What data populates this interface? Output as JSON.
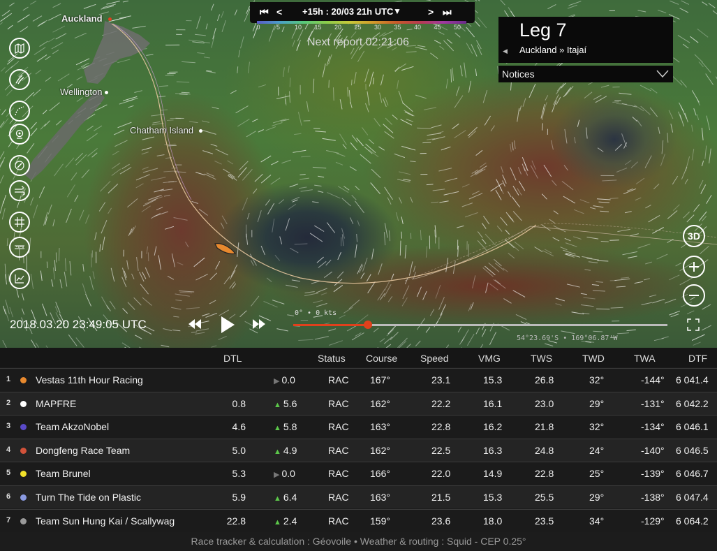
{
  "header": {
    "time_step": "+15h : 20/03 21h UTC",
    "next_report": "Next report 02:21:06",
    "scale_labels": [
      "0",
      "5",
      "10",
      "15",
      "20",
      "25",
      "30",
      "35",
      "40",
      "45",
      "50"
    ]
  },
  "leg": {
    "title": "Leg 7",
    "route": "Auckland » Itajaí",
    "notices_label": "Notices"
  },
  "places": {
    "auckland": "Auckland",
    "wellington": "Wellington",
    "chatham": "Chatham Island"
  },
  "map_controls": {
    "btn_3d": "3D"
  },
  "playback": {
    "datetime": "2018.03.20 23:49:05 UTC",
    "wind_readout": "0° • 0 kts",
    "progress": 0.2,
    "coords": "54°23.69'S • 169°06.87'W"
  },
  "table": {
    "columns": [
      "DTL",
      "Status",
      "Course",
      "Speed",
      "VMG",
      "TWS",
      "TWD",
      "TWA",
      "DTF"
    ],
    "rows": [
      {
        "rank": "1",
        "team": "Vestas 11th Hour Racing",
        "color": "#e8892e",
        "dtl": "",
        "trend": "▶",
        "trend_color": "#777",
        "delta": "0.0",
        "status": "RAC",
        "course": "167°",
        "speed": "23.1",
        "vmg": "15.3",
        "tws": "26.8",
        "twd": "32°",
        "twa": "-144°",
        "dtf": "6 041.4"
      },
      {
        "rank": "2",
        "team": "MAPFRE",
        "color": "#ffffff",
        "dtl": "0.8",
        "trend": "▲",
        "trend_color": "#5cc84a",
        "delta": "5.6",
        "status": "RAC",
        "course": "162°",
        "speed": "22.2",
        "vmg": "16.1",
        "tws": "23.0",
        "twd": "29°",
        "twa": "-131°",
        "dtf": "6 042.2"
      },
      {
        "rank": "3",
        "team": "Team AkzoNobel",
        "color": "#5a4ac8",
        "dtl": "4.6",
        "trend": "▲",
        "trend_color": "#5cc84a",
        "delta": "5.8",
        "status": "RAC",
        "course": "163°",
        "speed": "22.8",
        "vmg": "16.2",
        "tws": "21.8",
        "twd": "32°",
        "twa": "-134°",
        "dtf": "6 046.1"
      },
      {
        "rank": "4",
        "team": "Dongfeng Race Team",
        "color": "#d2523a",
        "dtl": "5.0",
        "trend": "▲",
        "trend_color": "#5cc84a",
        "delta": "4.9",
        "status": "RAC",
        "course": "162°",
        "speed": "22.5",
        "vmg": "16.3",
        "tws": "24.8",
        "twd": "24°",
        "twa": "-140°",
        "dtf": "6 046.5"
      },
      {
        "rank": "5",
        "team": "Team Brunel",
        "color": "#f0e02a",
        "dtl": "5.3",
        "trend": "▶",
        "trend_color": "#777",
        "delta": "0.0",
        "status": "RAC",
        "course": "166°",
        "speed": "22.0",
        "vmg": "14.9",
        "tws": "22.8",
        "twd": "25°",
        "twa": "-139°",
        "dtf": "6 046.7"
      },
      {
        "rank": "6",
        "team": "Turn The Tide on Plastic",
        "color": "#8a9ae0",
        "dtl": "5.9",
        "trend": "▲",
        "trend_color": "#5cc84a",
        "delta": "6.4",
        "status": "RAC",
        "course": "163°",
        "speed": "21.5",
        "vmg": "15.3",
        "tws": "25.5",
        "twd": "29°",
        "twa": "-138°",
        "dtf": "6 047.4"
      },
      {
        "rank": "7",
        "team": "Team Sun Hung Kai / Scallywag",
        "color": "#9a9a9a",
        "dtl": "22.8",
        "trend": "▲",
        "trend_color": "#5cc84a",
        "delta": "2.4",
        "status": "RAC",
        "course": "159°",
        "speed": "23.6",
        "vmg": "18.0",
        "tws": "23.5",
        "twd": "34°",
        "twa": "-129°",
        "dtf": "6 064.2"
      }
    ]
  },
  "footer": "Race tracker & calculation : Géovoile • Weather & routing : Squid - CEP 0.25°"
}
